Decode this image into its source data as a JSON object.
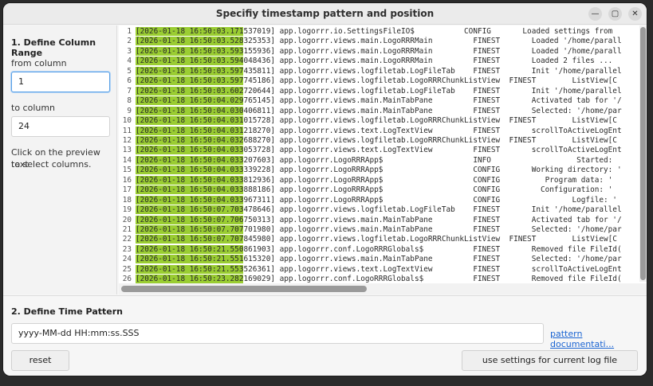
{
  "window": {
    "title": "Specifiy timestamp pattern and position",
    "min_glyph": "—",
    "max_glyph": "▢",
    "close_glyph": "✕"
  },
  "column_range": {
    "section_title": "1. Define Column Range",
    "from_label": "from column",
    "from_value": "1",
    "to_label": "to column",
    "to_value": "24",
    "help_line1": "Click on the preview text",
    "help_line2": "to select columns."
  },
  "log_lines": [
    {
      "n": "1",
      "ts": "[2026-01-18 16:50:03.171",
      "rest": "537019] app.logorrr.io.SettingsFileIO$           CONFIG       Loaded settings from"
    },
    {
      "n": "2",
      "ts": "[2026-01-18 16:50:03.528",
      "rest": "325353] app.logorrr.views.main.LogoRRRMain         FINEST       Loaded '/home/parall"
    },
    {
      "n": "3",
      "ts": "[2026-01-18 16:50:03.593",
      "rest": "155936] app.logorrr.views.main.LogoRRRMain         FINEST       Loaded '/home/parall"
    },
    {
      "n": "4",
      "ts": "[2026-01-18 16:50:03.594",
      "rest": "048436] app.logorrr.views.main.LogoRRRMain         FINEST       Loaded 2 files ..."
    },
    {
      "n": "5",
      "ts": "[2026-01-18 16:50:03.597",
      "rest": "435811] app.logorrr.views.logfiletab.LogFileTab    FINEST       Init '/home/parallel"
    },
    {
      "n": "6",
      "ts": "[2026-01-18 16:50:03.597",
      "rest": "745186] app.logorrr.views.logfiletab.LogoRRRChunkListView  FINEST        ListView[C"
    },
    {
      "n": "7",
      "ts": "[2026-01-18 16:50:03.602",
      "rest": "720644] app.logorrr.views.logfiletab.LogFileTab    FINEST       Init '/home/parallel"
    },
    {
      "n": "8",
      "ts": "[2026-01-18 16:50:04.029",
      "rest": "765145] app.logorrr.views.main.MainTabPane         FINEST       Activated tab for '/"
    },
    {
      "n": "9",
      "ts": "[2026-01-18 16:50:04.030",
      "rest": "406811] app.logorrr.views.main.MainTabPane         FINEST       Selected: '/home/par"
    },
    {
      "n": "10",
      "ts": "[2026-01-18 16:50:04.031",
      "rest": "015728] app.logorrr.views.logfiletab.LogoRRRChunkListView  FINEST        ListView[C"
    },
    {
      "n": "11",
      "ts": "[2026-01-18 16:50:04.031",
      "rest": "218270] app.logorrr.views.text.LogTextView         FINEST       scrollToActiveLogEnt"
    },
    {
      "n": "12",
      "ts": "[2026-01-18 16:50:04.032",
      "rest": "688270] app.logorrr.views.logfiletab.LogoRRRChunkListView  FINEST        ListView[C"
    },
    {
      "n": "13",
      "ts": "[2026-01-18 16:50:04.033",
      "rest": "053728] app.logorrr.views.text.LogTextView         FINEST       scrollToActiveLogEnt"
    },
    {
      "n": "14",
      "ts": "[2026-01-18 16:50:04.033",
      "rest": "207603] app.logorrr.LogoRRRApp$                    INFO                   Started:"
    },
    {
      "n": "15",
      "ts": "[2026-01-18 16:50:04.033",
      "rest": "339228] app.logorrr.LogoRRRApp$                    CONFIG       Working directory: '"
    },
    {
      "n": "16",
      "ts": "[2026-01-18 16:50:04.033",
      "rest": "812936] app.logorrr.LogoRRRApp$                    CONFIG          Program data: '"
    },
    {
      "n": "17",
      "ts": "[2026-01-18 16:50:04.033",
      "rest": "888186] app.logorrr.LogoRRRApp$                    CONFIG         Configuration: '"
    },
    {
      "n": "18",
      "ts": "[2026-01-18 16:50:04.033",
      "rest": "967311] app.logorrr.LogoRRRApp$                    CONFIG                Logfile: '"
    },
    {
      "n": "19",
      "ts": "[2026-01-18 16:50:07.703",
      "rest": "478646] app.logorrr.views.logfiletab.LogFileTab    FINEST       Init '/home/parallel"
    },
    {
      "n": "20",
      "ts": "[2026-01-18 16:50:07.706",
      "rest": "750313] app.logorrr.views.main.MainTabPane         FINEST       Activated tab for '/"
    },
    {
      "n": "21",
      "ts": "[2026-01-18 16:50:07.707",
      "rest": "701980] app.logorrr.views.main.MainTabPane         FINEST       Selected: '/home/par"
    },
    {
      "n": "22",
      "ts": "[2026-01-18 16:50:07.707",
      "rest": "845980] app.logorrr.views.logfiletab.LogoRRRChunkListView  FINEST        ListView[C"
    },
    {
      "n": "23",
      "ts": "[2026-01-18 16:50:21.550",
      "rest": "861903] app.logorrr.conf.LogoRRRGlobals$           FINEST       Removed file FileId("
    },
    {
      "n": "24",
      "ts": "[2026-01-18 16:50:21.551",
      "rest": "615320] app.logorrr.views.main.MainTabPane         FINEST       Selected: '/home/par"
    },
    {
      "n": "25",
      "ts": "[2026-01-18 16:50:21.553",
      "rest": "526361] app.logorrr.views.text.LogTextView         FINEST       scrollToActiveLogEnt"
    },
    {
      "n": "26",
      "ts": "[2026-01-18 16:50:23.282",
      "rest": "169029] app.logorrr.conf.LogoRRRGlobals$           FINEST       Removed file FileId("
    }
  ],
  "time_pattern": {
    "section_title": "2. Define Time Pattern",
    "pattern_value": "yyyy-MM-dd HH:mm:ss.SSS",
    "doc_link": "pattern documentati..."
  },
  "actions": {
    "reset_label": "reset",
    "apply_label": "use settings for current log file"
  },
  "colors": {
    "highlight": "#9acd32",
    "link": "#1a64d2",
    "focus": "#5aa0e6"
  }
}
